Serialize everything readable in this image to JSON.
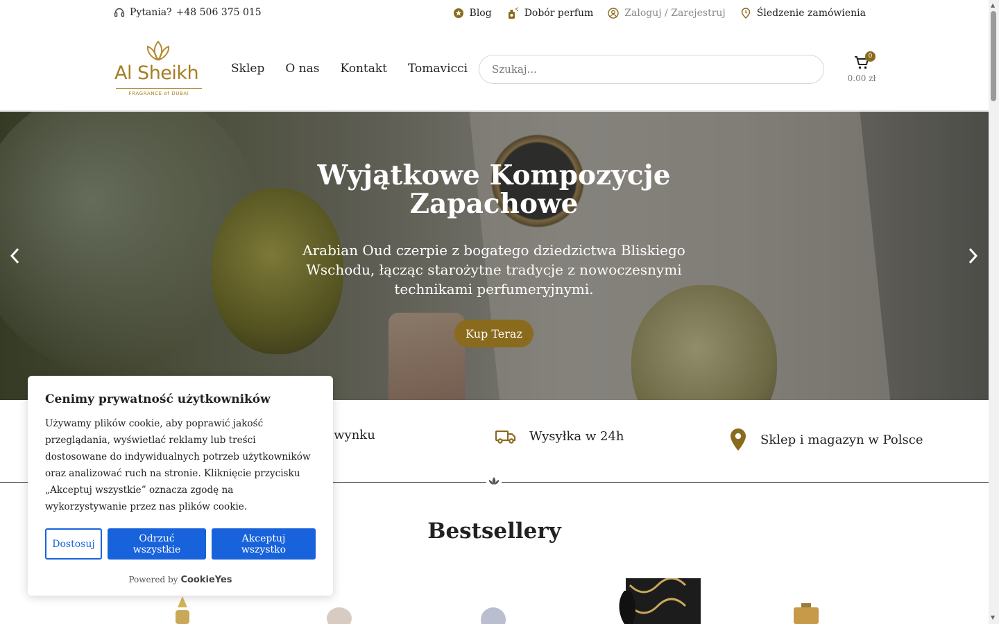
{
  "topbar": {
    "question_label": "Pytania?",
    "phone": "+48 506 375 015",
    "links": [
      {
        "label": "Blog",
        "icon": "star-badge-icon"
      },
      {
        "label": "Dobór perfum",
        "icon": "perfume-icon"
      },
      {
        "label": "Zaloguj / Zarejestruj",
        "icon": "user-circle-icon"
      },
      {
        "label": "Śledzenie zamówienia",
        "icon": "location-clock-icon"
      }
    ]
  },
  "logo": {
    "name": "Al Sheikh",
    "tagline": "FRAGRANCE of DUBAI"
  },
  "nav": {
    "items": [
      "Sklep",
      "O nas",
      "Kontakt",
      "Tomavicci"
    ]
  },
  "search": {
    "placeholder": "Szukaj..."
  },
  "cart": {
    "count": "0",
    "total": "0.00 zł"
  },
  "hero": {
    "title": "Wyjątkowe Kompozycje Zapachowe",
    "subtitle": "Arabian Oud czerpie z bogatego dziedzictwa Bliskiego Wschodu, łącząc starożytne tradycje z nowoczesnymi technikami perfumeryjnymi.",
    "cta": "Kup Teraz"
  },
  "features": [
    {
      "label": "25 lat na wynku",
      "icon": "award-icon"
    },
    {
      "label": "Wysyłka w 24h",
      "icon": "truck-icon"
    },
    {
      "label": "Sklep i magazyn w Polsce",
      "icon": "map-pin-icon"
    }
  ],
  "bestsellers": {
    "title": "Bestsellery"
  },
  "cookie": {
    "title": "Cenimy prywatność użytkowników",
    "text": "Używamy plików cookie, aby poprawić jakość przeglądania, wyświetlać reklamy lub treści dostosowane do indywidualnych potrzeb użytkowników oraz analizować ruch na stronie. Kliknięcie przycisku „Akceptuj wszystkie” oznacza zgodę na wykorzystywanie przez nas plików cookie.",
    "customize": "Dostosuj",
    "reject": "Odrzuć wszystkie",
    "accept": "Akceptuj wszystko",
    "powered_by": "Powered by",
    "brand": "CookieYes"
  },
  "colors": {
    "accent": "#8a6a1c",
    "logo_gold": "#a57d24",
    "cookie_blue": "#1863dc"
  }
}
